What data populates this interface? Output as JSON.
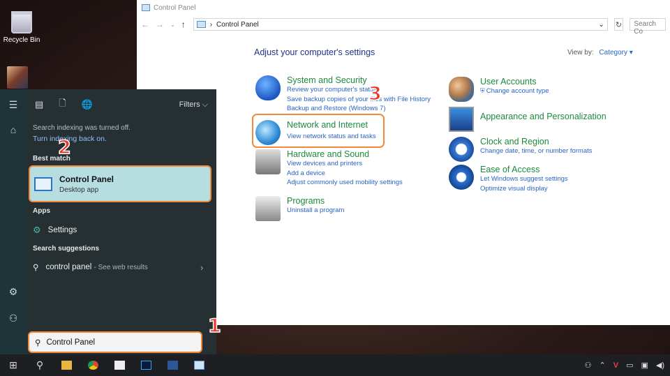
{
  "desktop": {
    "recycle_bin": "Recycle Bin"
  },
  "window": {
    "title": "Control Panel",
    "breadcrumb_sep": "›",
    "address": "Control Panel",
    "search_placeholder": "Search Co",
    "heading": "Adjust your computer's settings",
    "view_by_label": "View by:",
    "view_by_value": "Category ▾",
    "categories": [
      {
        "title": "System and Security",
        "links": [
          "Review your computer's status",
          "Save backup copies of your files with File History",
          "Backup and Restore (Windows 7)"
        ]
      },
      {
        "title": "Network and Internet",
        "links": [
          "View network status and tasks"
        ]
      },
      {
        "title": "Hardware and Sound",
        "links": [
          "View devices and printers",
          "Add a device",
          "Adjust commonly used mobility settings"
        ]
      },
      {
        "title": "Programs",
        "links": [
          "Uninstall a program"
        ]
      },
      {
        "title": "User Accounts",
        "links": [
          "Change account type"
        ]
      },
      {
        "title": "Appearance and Personalization",
        "links": []
      },
      {
        "title": "Clock and Region",
        "links": [
          "Change date, time, or number formats"
        ]
      },
      {
        "title": "Ease of Access",
        "links": [
          "Let Windows suggest settings",
          "Optimize visual display"
        ]
      }
    ]
  },
  "start_menu": {
    "filters": "Filters",
    "index_note": "Search indexing was turned off.",
    "index_link": "Turn indexing back on.",
    "best_match_label": "Best match",
    "best_match": {
      "name": "Control Panel",
      "kind": "Desktop app"
    },
    "apps_label": "Apps",
    "app_settings": "Settings",
    "suggestions_label": "Search suggestions",
    "suggestion": "control panel",
    "suggestion_suffix": "- See web results",
    "search_value": "Control Panel"
  },
  "badges": [
    "1",
    "2",
    "3"
  ],
  "colors": {
    "highlight": "#f08a3a",
    "badge": "#e8382c",
    "best_match_bg": "#b6dde0"
  }
}
